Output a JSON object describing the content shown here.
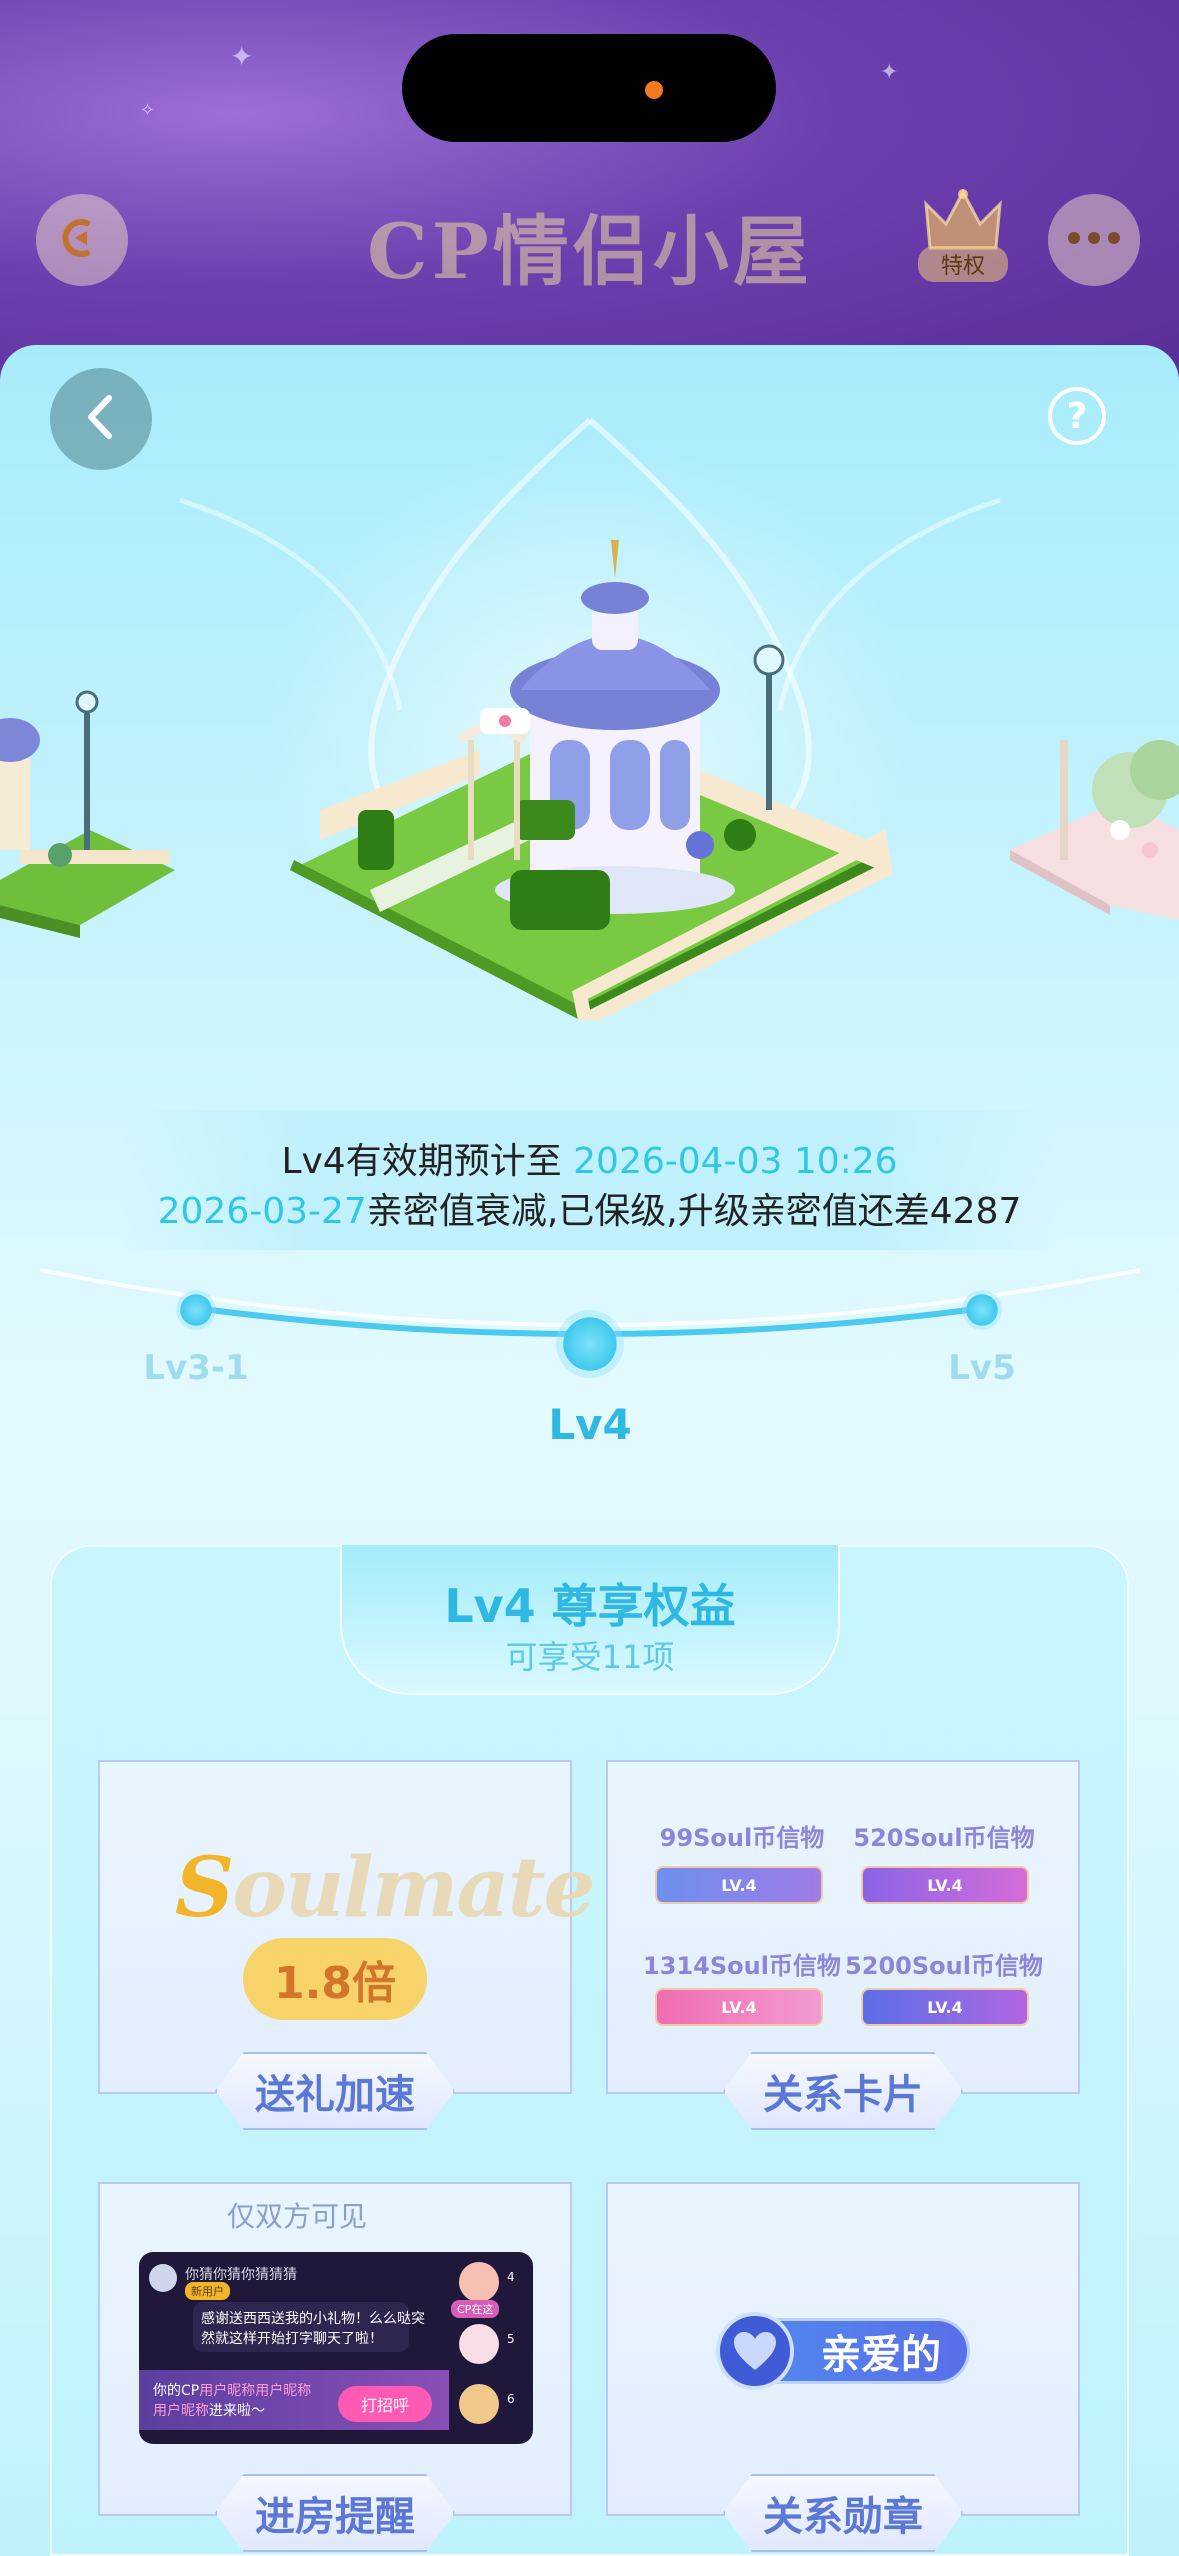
{
  "header": {
    "title": "CP情侣小屋",
    "privilege_label": "特权"
  },
  "info": {
    "line1_prefix": "Lv4有效期预计至 ",
    "line1_date": "2026-04-03 10:26",
    "line2_date": "2026-03-27",
    "line2_text": "亲密值衰减,已保级,升级亲密值还差4287"
  },
  "levels": {
    "prev": "Lv3-1",
    "current": "Lv4",
    "next": "Lv5"
  },
  "benefits": {
    "title": "Lv4 尊享权益",
    "subtitle": "可享受11项",
    "cards": [
      {
        "label": "送礼加速",
        "brand": "Soulmate",
        "multiplier": "1.8倍"
      },
      {
        "label": "关系卡片",
        "coins": [
          "99Soul币信物",
          "520Soul币信物",
          "1314Soul币信物",
          "5200Soul币信物"
        ],
        "ribbon_text": "LV.4"
      },
      {
        "label": "进房提醒",
        "visibility": "仅双方可见",
        "chat": {
          "user_name": "你猜你猜你猜猜猜",
          "user_tag": "新用户",
          "message_line1": "感谢送西西送我的小礼物！么么哒突",
          "message_line2": "然就这样开始打字聊天了啦！",
          "cp_tag": "CP在这",
          "notice_line1_a": "你的CP",
          "notice_line1_b": "用户昵称用户昵称",
          "notice_line2_a": "用户昵称",
          "notice_line2_b": "进来啦～",
          "greet_button": "打招呼",
          "seat_numbers": [
            "4",
            "5",
            "6"
          ]
        }
      },
      {
        "label": "关系勋章",
        "badge_text": "亲爱的"
      }
    ]
  },
  "colors": {
    "accent_cyan": "#2fc8e6",
    "card_label": "#5b78d6",
    "header_purple": "#6b3fae"
  }
}
